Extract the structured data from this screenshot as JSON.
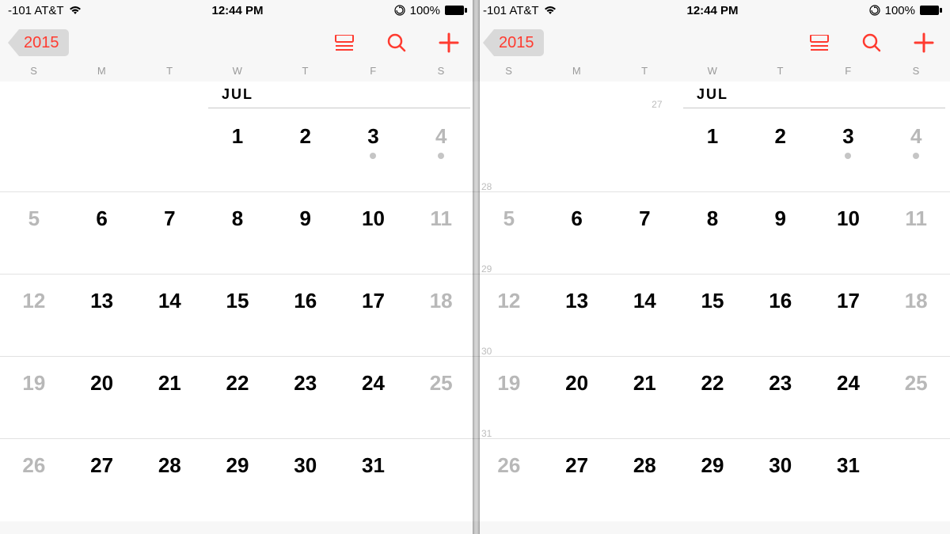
{
  "status": {
    "carrier": "-101 AT&T",
    "time": "12:44 PM",
    "battery_pct": "100%"
  },
  "nav": {
    "back_label": "2015"
  },
  "day_labels": [
    "S",
    "M",
    "T",
    "W",
    "T",
    "F",
    "S"
  ],
  "month_label": "JUL",
  "week_numbers": {
    "top": "27",
    "w2": "28",
    "w3": "29",
    "w4": "30",
    "w5": "31"
  },
  "weeks": [
    {
      "days": [
        {
          "n": "",
          "gray": false,
          "dot": false
        },
        {
          "n": "",
          "gray": false,
          "dot": false
        },
        {
          "n": "",
          "gray": false,
          "dot": false
        },
        {
          "n": "1",
          "gray": false,
          "dot": false
        },
        {
          "n": "2",
          "gray": false,
          "dot": false
        },
        {
          "n": "3",
          "gray": false,
          "dot": true
        },
        {
          "n": "4",
          "gray": true,
          "dot": true
        }
      ]
    },
    {
      "days": [
        {
          "n": "5",
          "gray": true,
          "dot": false
        },
        {
          "n": "6",
          "gray": false,
          "dot": false
        },
        {
          "n": "7",
          "gray": false,
          "dot": false
        },
        {
          "n": "8",
          "gray": false,
          "dot": false
        },
        {
          "n": "9",
          "gray": false,
          "dot": false
        },
        {
          "n": "10",
          "gray": false,
          "dot": false
        },
        {
          "n": "11",
          "gray": true,
          "dot": false
        }
      ]
    },
    {
      "days": [
        {
          "n": "12",
          "gray": true,
          "dot": false
        },
        {
          "n": "13",
          "gray": false,
          "dot": false
        },
        {
          "n": "14",
          "gray": false,
          "dot": false
        },
        {
          "n": "15",
          "gray": false,
          "dot": false
        },
        {
          "n": "16",
          "gray": false,
          "dot": false
        },
        {
          "n": "17",
          "gray": false,
          "dot": false
        },
        {
          "n": "18",
          "gray": true,
          "dot": false
        }
      ]
    },
    {
      "days": [
        {
          "n": "19",
          "gray": true,
          "dot": false
        },
        {
          "n": "20",
          "gray": false,
          "dot": false
        },
        {
          "n": "21",
          "gray": false,
          "dot": false
        },
        {
          "n": "22",
          "gray": false,
          "dot": false
        },
        {
          "n": "23",
          "gray": false,
          "dot": false
        },
        {
          "n": "24",
          "gray": false,
          "dot": false
        },
        {
          "n": "25",
          "gray": true,
          "dot": false
        }
      ]
    },
    {
      "days": [
        {
          "n": "26",
          "gray": true,
          "dot": false
        },
        {
          "n": "27",
          "gray": false,
          "dot": false
        },
        {
          "n": "28",
          "gray": false,
          "dot": false
        },
        {
          "n": "29",
          "gray": false,
          "dot": false
        },
        {
          "n": "30",
          "gray": false,
          "dot": false
        },
        {
          "n": "31",
          "gray": false,
          "dot": false
        },
        {
          "n": "",
          "gray": false,
          "dot": false
        }
      ]
    }
  ]
}
